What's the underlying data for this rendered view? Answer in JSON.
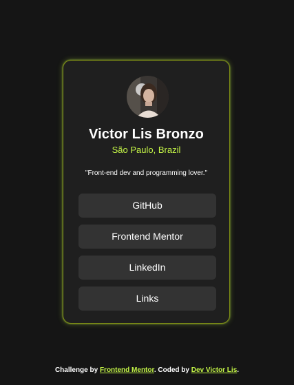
{
  "profile": {
    "name": "Victor Lis Bronzo",
    "location": "São Paulo, Brazil",
    "bio": "\"Front-end dev and programming lover.\""
  },
  "links": [
    {
      "label": "GitHub"
    },
    {
      "label": "Frontend Mentor"
    },
    {
      "label": "LinkedIn"
    },
    {
      "label": "Links"
    }
  ],
  "footer": {
    "prefix": "Challenge by ",
    "challenge_link": "Frontend Mentor",
    "middle": ". Coded by ",
    "author_link": "Dev Victor Lis",
    "suffix": "."
  },
  "colors": {
    "background": "#151515",
    "card": "#1f1f1f",
    "button": "#333333",
    "accent": "#c4f547"
  }
}
